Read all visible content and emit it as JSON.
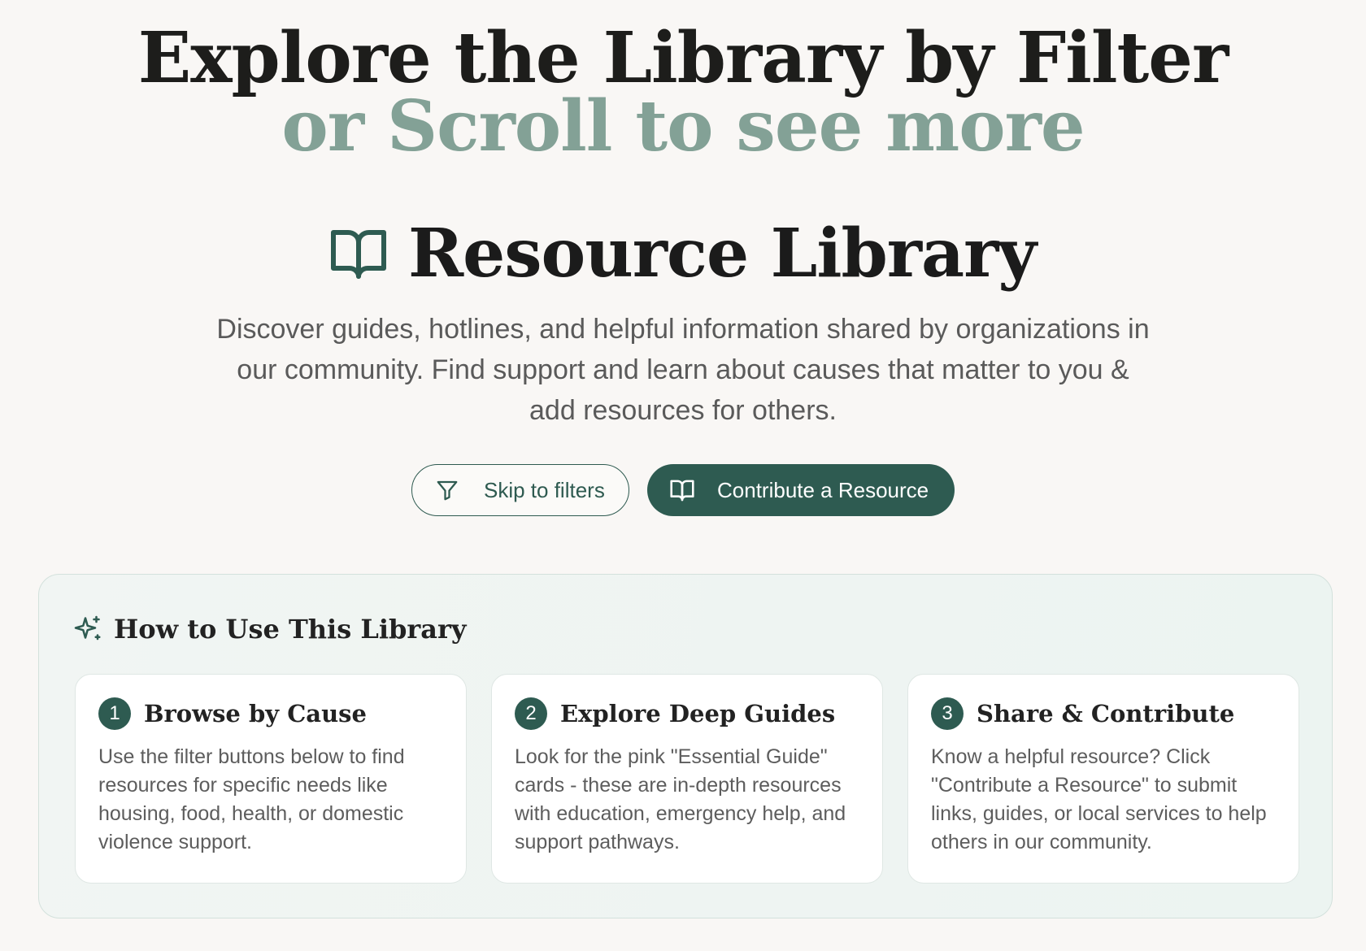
{
  "hero": {
    "line1": "Explore the Library by Filter",
    "line2": "or Scroll to see more"
  },
  "library": {
    "title": "Resource Library",
    "description": "Discover guides, hotlines, and helpful information shared by organizations in our community. Find support and learn about causes that matter to you & add resources for others."
  },
  "buttons": {
    "skip_filters": "Skip to filters",
    "contribute": "Contribute a Resource"
  },
  "how_to": {
    "title": "How to Use This Library",
    "steps": [
      {
        "number": "1",
        "title": "Browse by Cause",
        "body": "Use the filter buttons below to find resources for specific needs like housing, food, health, or domestic violence support."
      },
      {
        "number": "2",
        "title": "Explore Deep Guides",
        "body": "Look for the pink \"Essential Guide\" cards - these are in-depth resources with education, emergency help, and support pathways."
      },
      {
        "number": "3",
        "title": "Share & Contribute",
        "body": "Know a helpful resource? Click \"Contribute a Resource\" to submit links, guides, or local services to help others in our community."
      }
    ]
  },
  "icons": {
    "library": "book-open-icon",
    "filter": "filter-icon",
    "contribute": "book-open-icon",
    "how_to": "sparkles-icon"
  },
  "colors": {
    "primary": "#2e5b51",
    "accent_muted": "#83a196",
    "background": "#f9f7f5"
  }
}
